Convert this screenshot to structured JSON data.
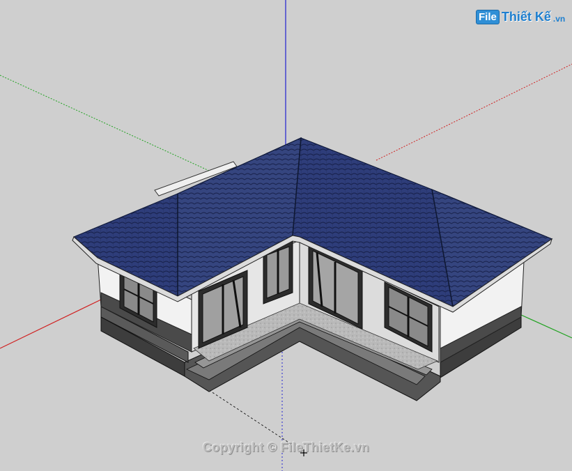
{
  "logo": {
    "badge": "File",
    "name": "Thiết Kế",
    "tld": ".vn"
  },
  "watermark": {
    "copyright": "Copyright © FileThietKe.vn"
  },
  "icons": {
    "cursor": "crosshair-cursor-icon"
  },
  "colors": {
    "background": "#cfcfcf",
    "roof": "#2b3a73",
    "wall": "#f2f2f2",
    "axis_red": "#d02020",
    "axis_green": "#1fa21f",
    "axis_blue": "#2020d0"
  }
}
